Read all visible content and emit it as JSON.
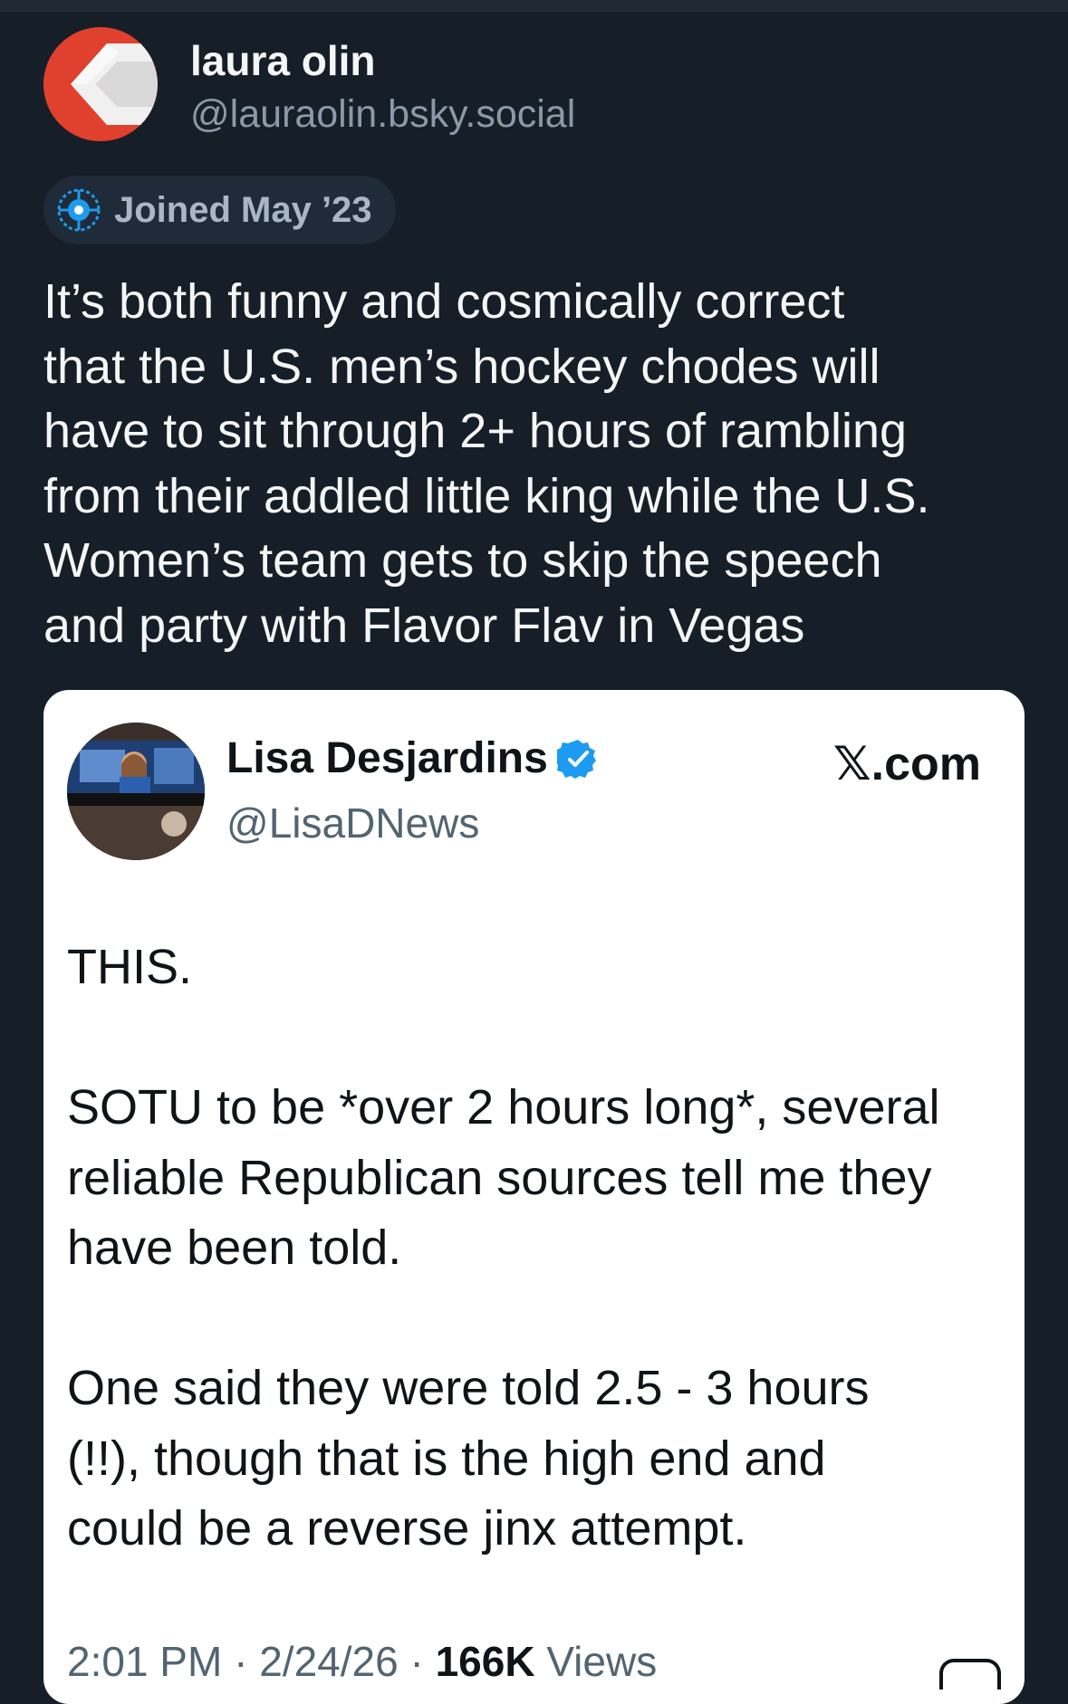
{
  "post": {
    "author": {
      "display_name": "laura olin",
      "handle": "@lauraolin.bsky.social",
      "avatar_icon": "red-arrow-avatar"
    },
    "joined_badge": {
      "icon": "starter-pack-icon",
      "label": "Joined May ’23"
    },
    "text_lines": [
      "It’s both funny and cosmically correct",
      "that the U.S. men’s hockey chodes will",
      "have to sit through 2+ hours of rambling",
      "from their addled little king while the U.S.",
      "Women’s team gets to skip the speech",
      "and party with Flavor Flav in Vegas"
    ]
  },
  "embed": {
    "author": {
      "display_name": "Lisa Desjardins",
      "handle": "@LisaDNews",
      "verified": true,
      "verified_icon": "verified-badge-icon"
    },
    "source": "𝕏.com",
    "paragraphs": [
      [
        "THIS."
      ],
      [
        "SOTU to be *over 2 hours long*, several",
        "reliable Republican sources tell me they",
        "have been told."
      ],
      [
        "One said they were told 2.5 - 3 hours",
        "(!!),  though that is the high end and",
        "could be a reverse jinx attempt."
      ]
    ],
    "meta": {
      "time": "2:01 PM",
      "date": "2/24/26",
      "views_count": "166K",
      "views_label": "Views"
    }
  },
  "colors": {
    "background": "#161e27",
    "text_primary": "#f4f6f8",
    "text_secondary": "#8b98a8",
    "pill_bg": "#1f2b38",
    "card_bg": "#ffffff",
    "verified_blue": "#1d9bf0"
  }
}
